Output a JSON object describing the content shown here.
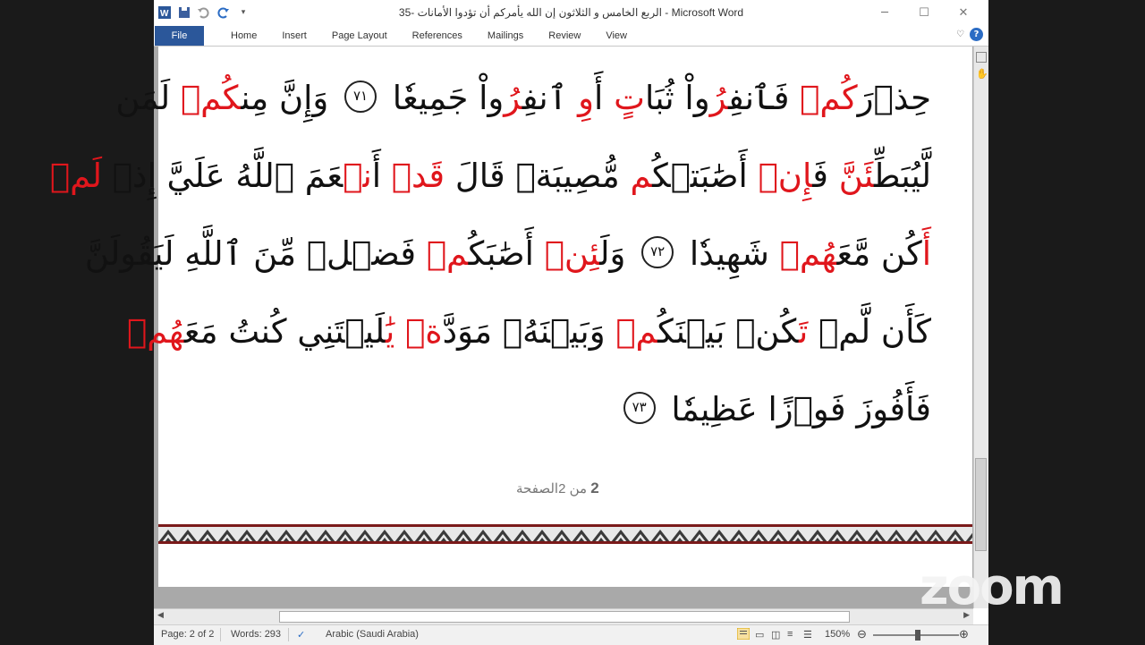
{
  "window": {
    "title": "35- الربع  الخامس و الثلاثون إن الله يأمركم أن تؤدوا الأمانات  -  Microsoft Word",
    "controls": {
      "minimize": "─",
      "maximize": "☐",
      "close": "✕"
    }
  },
  "ribbon": {
    "file_label": "File",
    "tabs": [
      "Home",
      "Insert",
      "Page Layout",
      "References",
      "Mailings",
      "Review",
      "View"
    ]
  },
  "document": {
    "lines": [
      [
        {
          "t": "حِذۡرَ",
          "c": "n"
        },
        {
          "t": "كُمۡ",
          "c": "r"
        },
        {
          "t": " فَٱنفِ",
          "c": "n"
        },
        {
          "t": "رُ",
          "c": "r"
        },
        {
          "t": "واْ ثُبَا",
          "c": "n"
        },
        {
          "t": "تٍ",
          "c": "r"
        },
        {
          "t": " أَ",
          "c": "n"
        },
        {
          "t": "وِ",
          "c": "r"
        },
        {
          "t": " ٱنفِ",
          "c": "n"
        },
        {
          "t": "رُ",
          "c": "r"
        },
        {
          "t": "واْ جَمِيعٗا ",
          "c": "n"
        },
        {
          "t": "٧١",
          "c": "a"
        },
        {
          "t": " وَإِنَّ مِن",
          "c": "n"
        },
        {
          "t": "كُمۡ",
          "c": "r"
        },
        {
          "t": " لَمَن",
          "c": "n"
        }
      ],
      [
        {
          "t": "لَّيُبَطِّ",
          "c": "n"
        },
        {
          "t": "ئَنَّ",
          "c": "r"
        },
        {
          "t": " فَ",
          "c": "n"
        },
        {
          "t": "إِنۡ",
          "c": "r"
        },
        {
          "t": " أَصَٰبَتۡكُ",
          "c": "n"
        },
        {
          "t": "م",
          "c": "r"
        },
        {
          "t": " مُّصِيبَةٞ قَالَ ",
          "c": "n"
        },
        {
          "t": "قَدۡ",
          "c": "r"
        },
        {
          "t": " أَ",
          "c": "n"
        },
        {
          "t": "نۡ",
          "c": "r"
        },
        {
          "t": "عَمَ ٱللَّهُ عَلَيَّ إِذۡ ",
          "c": "n"
        },
        {
          "t": "لَمۡ",
          "c": "r"
        }
      ],
      [
        {
          "t": "أَ",
          "c": "r"
        },
        {
          "t": "كُن مَّعَ",
          "c": "n"
        },
        {
          "t": "هُمۡ",
          "c": "r"
        },
        {
          "t": " شَهِيدٗا ",
          "c": "n"
        },
        {
          "t": "٧٢",
          "c": "a"
        },
        {
          "t": " وَلَ",
          "c": "n"
        },
        {
          "t": "ئِنۡ",
          "c": "r"
        },
        {
          "t": " أَصَٰبَكُ",
          "c": "n"
        },
        {
          "t": "مۡ",
          "c": "r"
        },
        {
          "t": " فَضۡلٞ مِّنَ ٱللَّهِ لَيَقُولَنَّ",
          "c": "n"
        }
      ],
      [
        {
          "t": "كَأَن لَّمۡ ",
          "c": "n"
        },
        {
          "t": "تَ",
          "c": "r"
        },
        {
          "t": "كُنۢ بَيۡنَكُ",
          "c": "n"
        },
        {
          "t": "مۡ",
          "c": "r"
        },
        {
          "t": " وَبَيۡنَهُۥ مَوَدَّ",
          "c": "n"
        },
        {
          "t": "ةٞ",
          "c": "r"
        },
        {
          "t": " ",
          "c": "n"
        },
        {
          "t": "يَٰ",
          "c": "r"
        },
        {
          "t": "لَيۡتَنِي كُنتُ مَعَ",
          "c": "n"
        },
        {
          "t": "هُمۡ",
          "c": "r"
        }
      ],
      [
        {
          "t": "فَأَفُوزَ فَوۡزًا عَظِيمٗا ",
          "c": "n"
        },
        {
          "t": "٧٣",
          "c": "a"
        }
      ]
    ],
    "page_label_num": "2",
    "page_label_text": " من 2الصفحة"
  },
  "status": {
    "page": "Page: 2 of 2",
    "words": "Words: 293",
    "language": "Arabic (Saudi Arabia)",
    "zoom": "150%",
    "zoom_level": 0.5
  },
  "overlay": {
    "logo_text": "zoom"
  },
  "colors": {
    "accent": "#2b579a",
    "verse_red": "#e0161c"
  }
}
